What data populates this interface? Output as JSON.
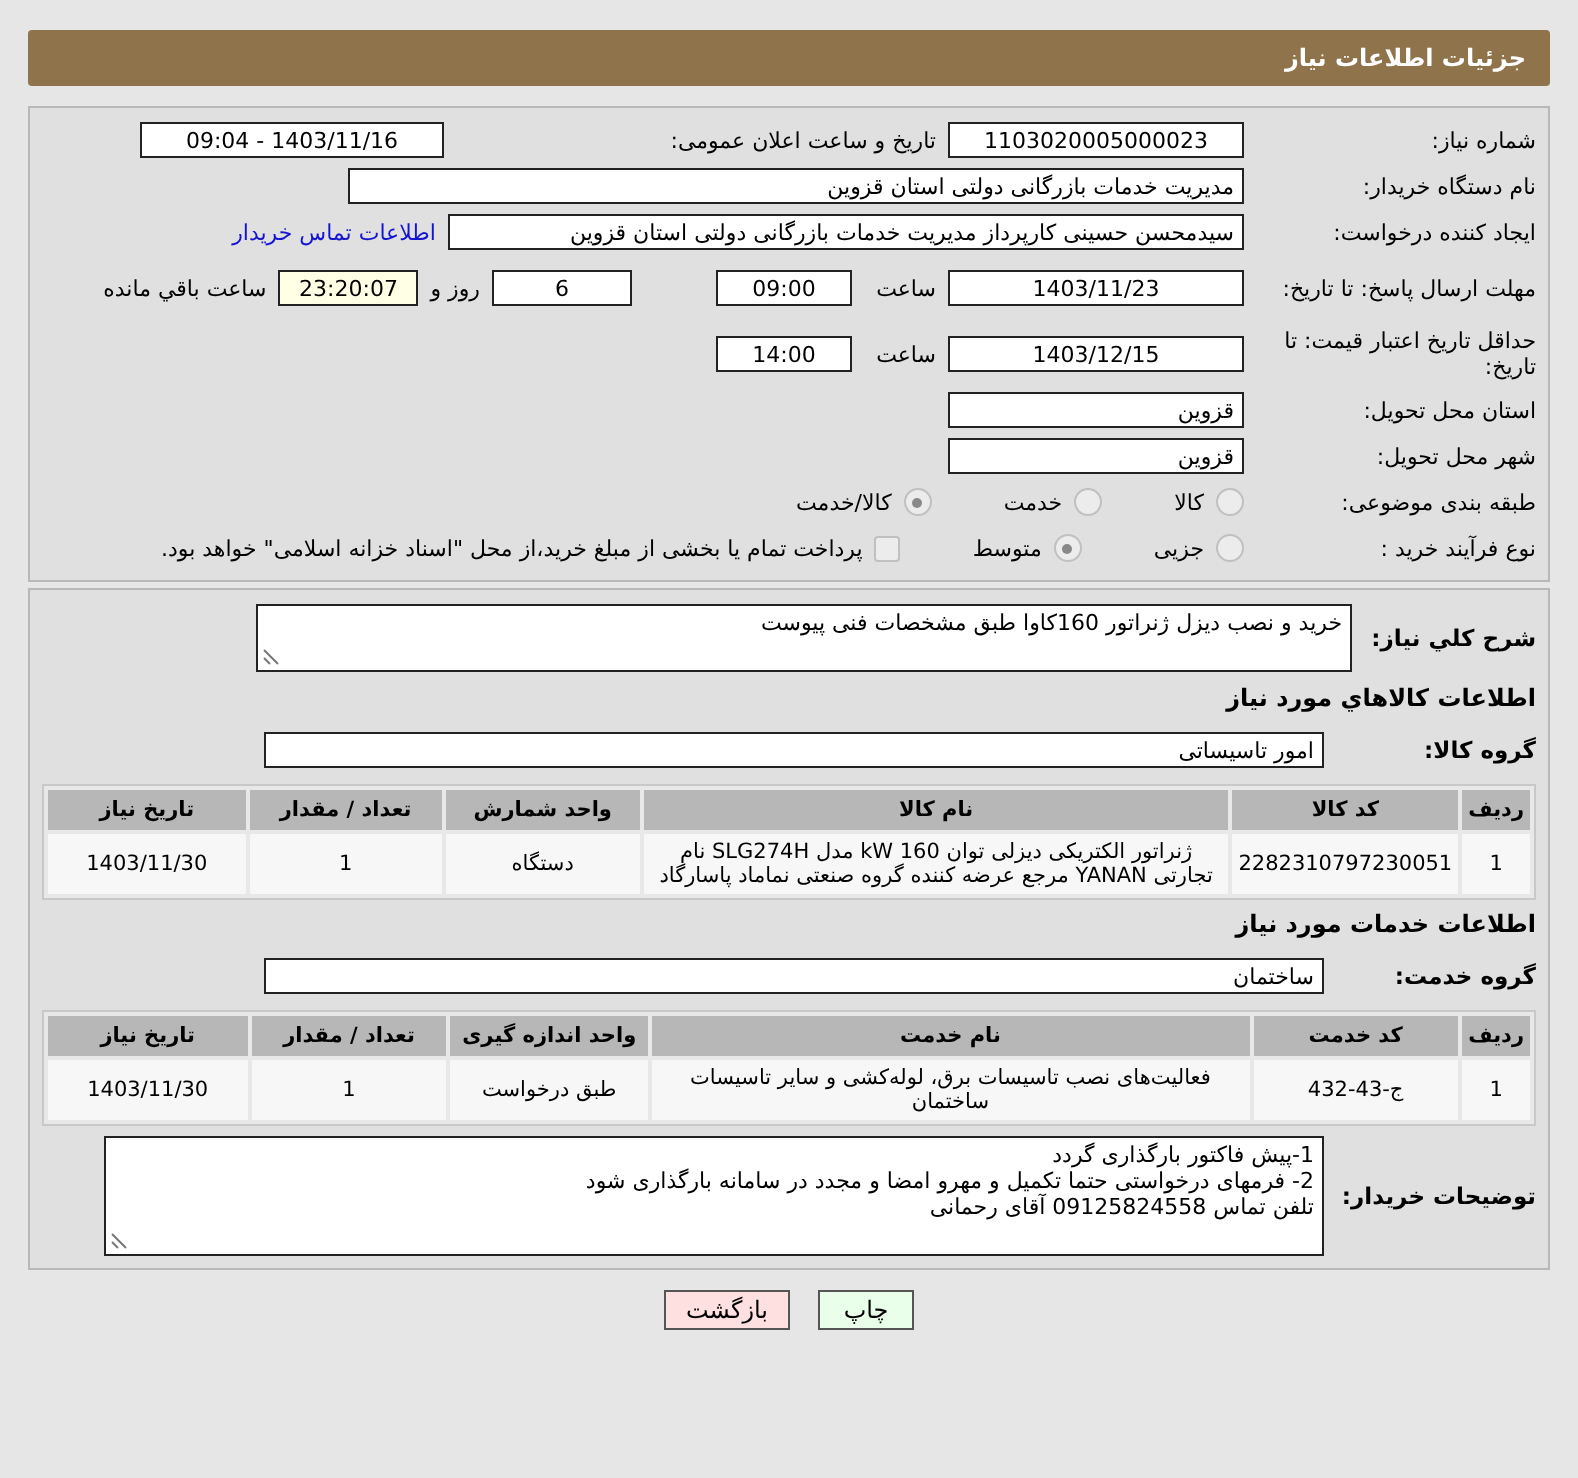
{
  "header": {
    "title": "جزئیات اطلاعات نیاز"
  },
  "need_number": {
    "label": "شماره نیاز:",
    "value": "1103020005000023"
  },
  "announce_date": {
    "label": "تاریخ و ساعت اعلان عمومی:",
    "value": "1403/11/16 - 09:04"
  },
  "buyer_org": {
    "label": "نام دستگاه خریدار:",
    "value": "مدیریت خدمات بازرگانی دولتی استان قزوین"
  },
  "requester": {
    "label": "ایجاد کننده درخواست:",
    "value": "سیدمحسن  حسینی کارپرداز مدیریت خدمات بازرگانی دولتی استان قزوین",
    "link": "اطلاعات تماس خریدار"
  },
  "reply_deadline": {
    "label": "مهلت ارسال پاسخ: تا تاریخ:",
    "date": "1403/11/23",
    "time_label": "ساعت",
    "time": "09:00",
    "days": "6",
    "days_label": "روز و",
    "remaining": "23:20:07",
    "remaining_label": "ساعت باقي مانده"
  },
  "price_validity": {
    "label": "حداقل تاریخ اعتبار قیمت: تا تاریخ:",
    "date": "1403/12/15",
    "time_label": "ساعت",
    "time": "14:00"
  },
  "province": {
    "label": "استان محل تحویل:",
    "value": "قزوین"
  },
  "city": {
    "label": "شهر محل تحویل:",
    "value": "قزوین"
  },
  "category": {
    "label": "طبقه بندی موضوعی:",
    "options": [
      {
        "label": "کالا",
        "selected": false
      },
      {
        "label": "خدمت",
        "selected": false
      },
      {
        "label": "کالا/خدمت",
        "selected": true
      }
    ]
  },
  "process": {
    "label": "نوع فرآیند خرید :",
    "options": [
      {
        "label": "جزیی",
        "selected": false
      },
      {
        "label": "متوسط",
        "selected": true
      }
    ],
    "payment": {
      "label": "پرداخت تمام یا بخشی از مبلغ خرید،از محل \"اسناد خزانه اسلامی\" خواهد بود.",
      "checked": false
    }
  },
  "description": {
    "label": "شرح کلي نیاز:",
    "value": "خرید و نصب دیزل ژنراتور 160کاوا طبق مشخصات فنی پیوست"
  },
  "goods": {
    "title": "اطلاعات کالاهاي مورد نياز",
    "group_label": "گروه کالا:",
    "group": "امور تاسیساتی",
    "columns": [
      "ردیف",
      "کد کالا",
      "نام کالا",
      "واحد شمارش",
      "تعداد / مقدار",
      "تاریخ نیاز"
    ],
    "rows": [
      [
        "1",
        "2282310797230051",
        "ژنراتور الکتریکی دیزلی توان 160 kW مدل SLG274H نام تجارتی YANAN مرجع عرضه کننده گروه صنعتی نماماد پاسارگاد",
        "دستگاه",
        "1",
        "1403/11/30"
      ]
    ]
  },
  "services": {
    "title": "اطلاعات خدمات مورد نیاز",
    "group_label": "گروه خدمت:",
    "group": "ساختمان",
    "columns": [
      "ردیف",
      "کد خدمت",
      "نام خدمت",
      "واحد اندازه گیری",
      "تعداد / مقدار",
      "تاریخ نیاز"
    ],
    "rows": [
      [
        "1",
        "ج-43-432",
        "فعالیت‌های نصب تاسیسات برق، لوله‌کشی و سایر تاسیسات ساختمان",
        "طبق درخواست",
        "1",
        "1403/11/30"
      ]
    ]
  },
  "buyer_notes": {
    "label": "توضیحات خریدار:",
    "lines": [
      "1-پیش فاکتور بارگذاری گردد",
      "2- فرمهای درخواستی حتما تکمیل و مهرو امضا و مجدد در سامانه بارگذاری شود",
      "تلفن تماس 09125824558  آقای رحمانی"
    ]
  },
  "buttons": [
    {
      "label": "چاپ",
      "kind": "print"
    },
    {
      "label": "بازگشت",
      "kind": "back"
    }
  ]
}
